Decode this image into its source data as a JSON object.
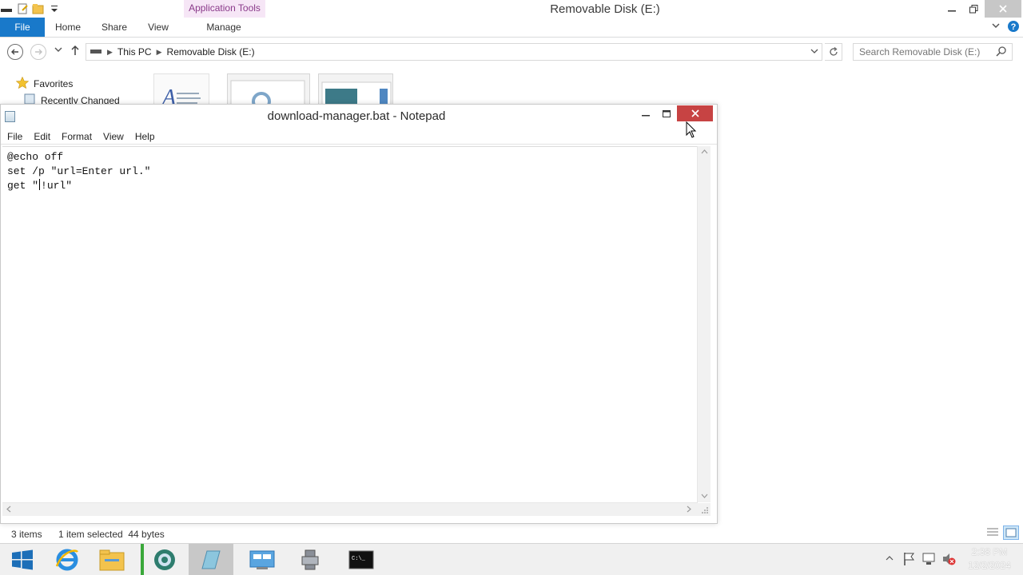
{
  "explorer": {
    "title": "Removable Disk (E:)",
    "contextual_tab": "Application Tools",
    "tabs": [
      {
        "label": "File"
      },
      {
        "label": "Home"
      },
      {
        "label": "Share"
      },
      {
        "label": "View"
      },
      {
        "label": "Manage"
      }
    ],
    "breadcrumb": [
      "This PC",
      "Removable Disk (E:)"
    ],
    "search_placeholder": "Search Removable Disk (E:)",
    "nav": {
      "favorites": "Favorites",
      "recently_changed": "Recently Changed"
    },
    "status": {
      "items": "3 items",
      "selected": "1 item selected  44 bytes"
    }
  },
  "notepad": {
    "title": "download-manager.bat - Notepad",
    "menu": [
      "File",
      "Edit",
      "Format",
      "View",
      "Help"
    ],
    "lines": [
      "@echo off",
      "set /p \"url=Enter url.\"",
      "get \"",
      "!url\""
    ]
  },
  "taskbar": {
    "time": "2:38 PM",
    "date": "12/2/2024"
  },
  "colors": {
    "accent": "#1979ca",
    "close_red": "#c74343",
    "contextual_tab": "#8a3a8a"
  }
}
